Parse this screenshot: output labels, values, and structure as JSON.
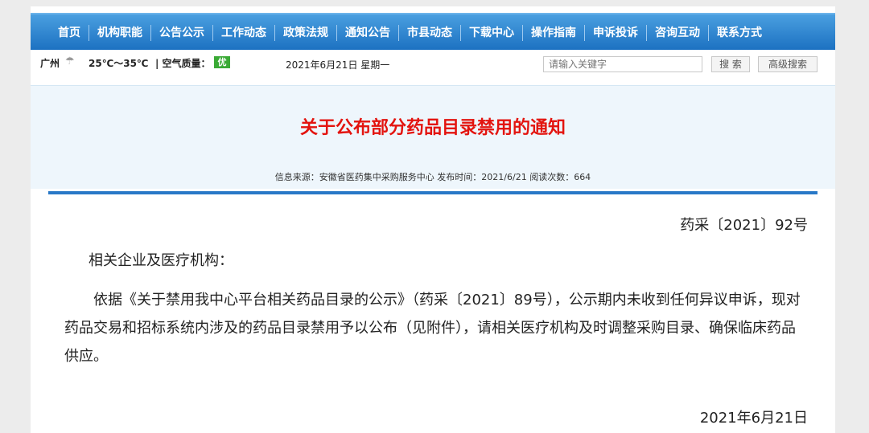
{
  "nav": {
    "items": [
      "首页",
      "机构职能",
      "公告公示",
      "工作动态",
      "政策法规",
      "通知公告",
      "市县动态",
      "下载中心",
      "操作指南",
      "申诉投诉",
      "咨询互动",
      "联系方式"
    ]
  },
  "infobar": {
    "city": "广州",
    "weather_icon": "cloudy-weather-icon",
    "temperature": "25℃～35℃",
    "air_quality_label": "| 空气质量：",
    "air_quality_value": "优",
    "date": "2021年6月21日 星期一",
    "search_placeholder": "请输入关键字",
    "search_button": "搜 索",
    "advanced_search_button": "高级搜索"
  },
  "article": {
    "title": "关于公布部分药品目录禁用的通知",
    "meta": "信息来源：安徽省医药集中采购服务中心 发布时间：2021/6/21 阅读次数：664",
    "doc_number": "药采〔2021〕92号",
    "salutation": "相关企业及医疗机构：",
    "body": "依据《关于禁用我中心平台相关药品目录的公示》（药采〔2021〕89号），公示期内未收到任何异议申诉，现对药品交易和招标系统内涉及的药品目录禁用予以公布（见附件），请相关医疗机构及时调整采购目录、确保临床药品供应。",
    "sign_date": "2021年6月21日"
  },
  "colors": {
    "nav_blue": "#1a6fc0",
    "title_red": "#e3140f",
    "air_quality_green": "#3aaa35",
    "rule_blue": "#2878c7"
  }
}
